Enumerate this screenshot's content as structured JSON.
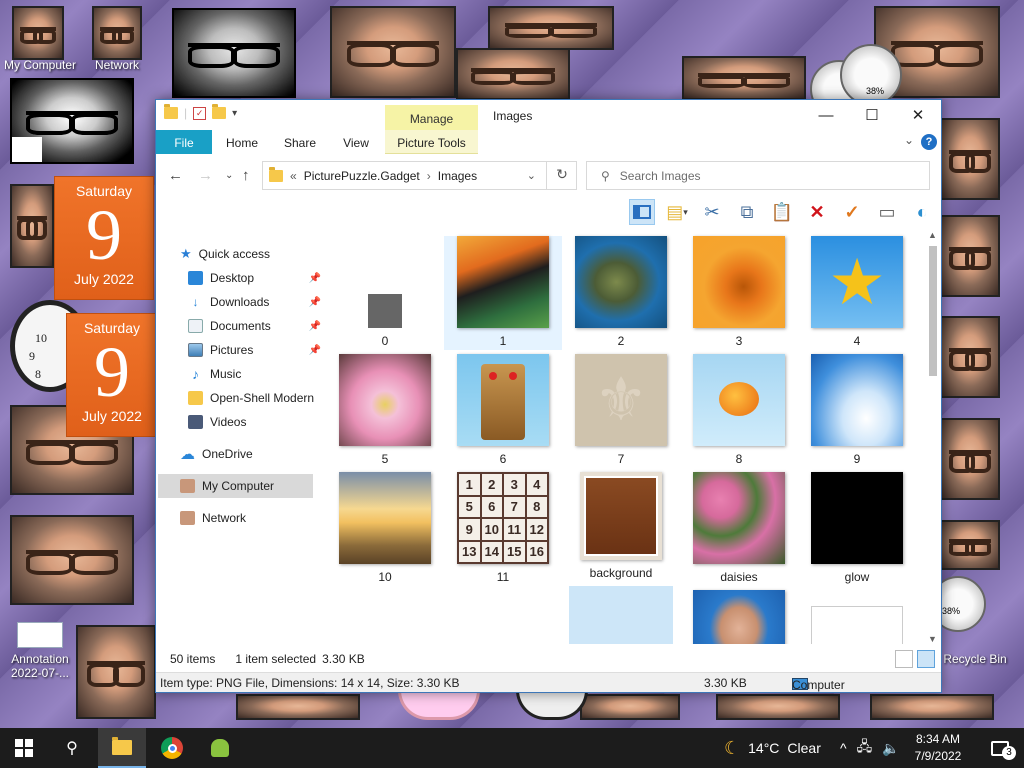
{
  "desktop": {
    "icons": [
      {
        "label": "My Computer"
      },
      {
        "label": "Network"
      },
      {
        "label": "Annotation 2022-07-..."
      },
      {
        "label": "Recycle Bin"
      }
    ],
    "calendar_1": {
      "weekday": "Saturday",
      "day": "9",
      "month_year": "July 2022"
    },
    "calendar_2": {
      "weekday": "Saturday",
      "day": "9",
      "month_year": "July 2022"
    },
    "gauge_1": {
      "value": "38%"
    },
    "gauge_2": {
      "value": "38%"
    }
  },
  "window": {
    "title": "Images",
    "context_tab": "Manage",
    "controls": {
      "minimize": "—",
      "maximize": "☐",
      "close": "✕"
    },
    "ribbon_tabs": [
      "File",
      "Home",
      "Share",
      "View",
      "Picture Tools"
    ],
    "address": {
      "overflow": "«",
      "parts": [
        "PicturePuzzle.Gadget",
        "Images"
      ]
    },
    "search": {
      "placeholder": "Search Images"
    },
    "nav": {
      "quick_access": "Quick access",
      "items": [
        {
          "label": "Desktop",
          "pinned": true
        },
        {
          "label": "Downloads",
          "pinned": true
        },
        {
          "label": "Documents",
          "pinned": true
        },
        {
          "label": "Pictures",
          "pinned": true
        },
        {
          "label": "Music",
          "pinned": false
        },
        {
          "label": "Open-Shell Modern",
          "pinned": false
        },
        {
          "label": "Videos",
          "pinned": false
        }
      ],
      "onedrive": "OneDrive",
      "my_computer": "My Computer",
      "network": "Network"
    },
    "files": [
      {
        "name": "0"
      },
      {
        "name": "1"
      },
      {
        "name": "2"
      },
      {
        "name": "3"
      },
      {
        "name": "4"
      },
      {
        "name": "5"
      },
      {
        "name": "6"
      },
      {
        "name": "7"
      },
      {
        "name": "8"
      },
      {
        "name": "9"
      },
      {
        "name": "10"
      },
      {
        "name": "11"
      },
      {
        "name": "background"
      },
      {
        "name": "daisies"
      },
      {
        "name": "glow"
      }
    ],
    "status": {
      "count": "50 items",
      "selection": "1 item selected",
      "size": "3.30 KB"
    },
    "details": {
      "item_info": "Item type: PNG File, Dimensions: 14 x 14, Size: 3.30 KB",
      "size": "3.30 KB",
      "location": "Computer"
    }
  },
  "puzzle_tiles": [
    "1",
    "2",
    "3",
    "4",
    "5",
    "6",
    "7",
    "8",
    "9",
    "10",
    "11",
    "12",
    "13",
    "14",
    "15",
    "16"
  ],
  "taskbar": {
    "weather": {
      "temp": "14°C",
      "condition": "Clear"
    },
    "time": "8:34 AM",
    "date": "7/9/2022",
    "notification_count": "3"
  },
  "colors": {
    "accent": "#19a0c6",
    "selection": "#cce4f7",
    "manage_tab": "#f6f3a6",
    "calendar": "#f0742a"
  }
}
